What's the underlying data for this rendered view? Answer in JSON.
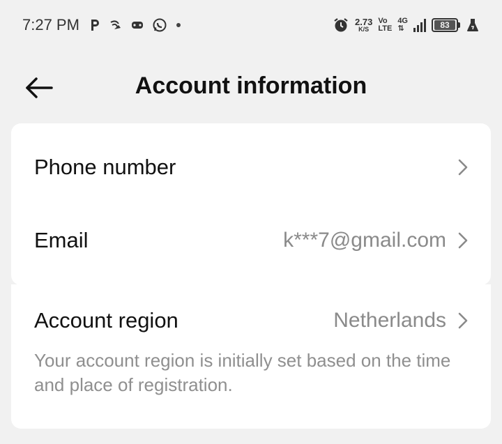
{
  "status_bar": {
    "time": "7:27 PM",
    "left_icons": [
      "parking-app-icon",
      "satellite-icon",
      "game-controller-icon",
      "whatsapp-icon",
      "dot-icon"
    ],
    "speed_value": "2.73",
    "speed_unit": "K/S",
    "volte_top": "Vo",
    "volte_bottom": "LTE",
    "network_top": "4G",
    "network_bottom": "⇅",
    "battery": "83",
    "right_icons": [
      "alarm-icon",
      "signal-bars-icon",
      "battery-icon",
      "flask-icon"
    ]
  },
  "header": {
    "title": "Account information",
    "back_icon": "arrow-left-icon"
  },
  "account_rows": [
    {
      "label": "Phone number",
      "value": ""
    },
    {
      "label": "Email",
      "value": "k***7@gmail.com"
    }
  ],
  "region": {
    "label": "Account region",
    "value": "Netherlands",
    "description": "Your account region is initially set based on the time and place of registration."
  },
  "colors": {
    "background": "#f1f1f1",
    "card": "#ffffff",
    "primary_text": "#111111",
    "secondary_text": "#8a8a8a"
  }
}
